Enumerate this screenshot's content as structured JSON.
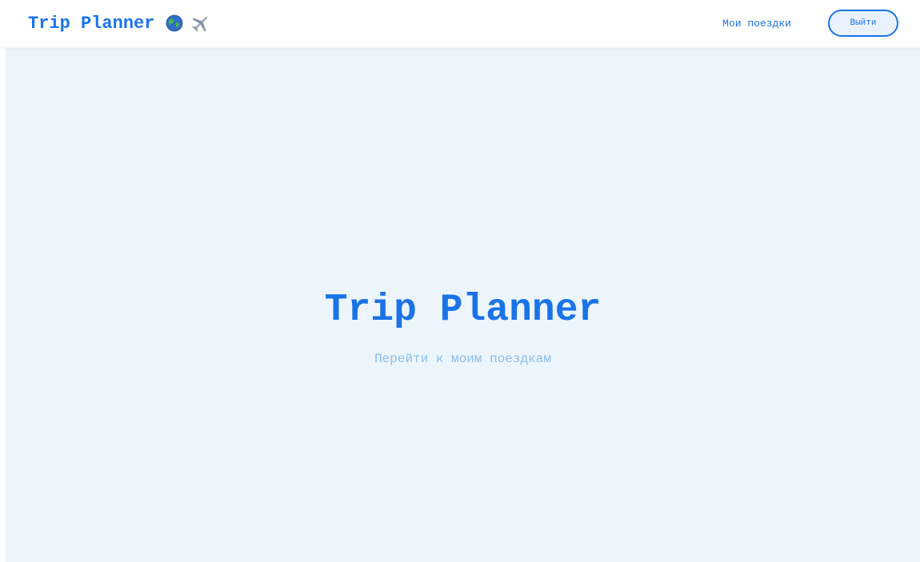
{
  "navbar": {
    "brand": "Trip Planner",
    "brand_icons": [
      "globe-icon",
      "airplane-icon"
    ],
    "links": [
      {
        "label": "Мои поездки"
      }
    ],
    "logout_label": "Выйти"
  },
  "hero": {
    "title": "Trip Planner",
    "link_label": "Перейти к моим поездкам"
  },
  "colors": {
    "accent": "#1a73e8",
    "background": "#ecf5fc",
    "muted_link": "#8bbcec",
    "button_fill": "#eaf3fd"
  }
}
